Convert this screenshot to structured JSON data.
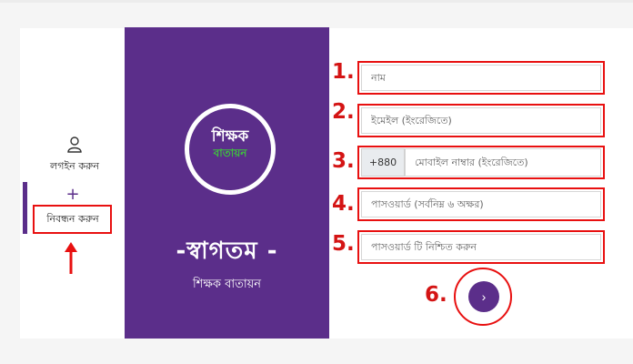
{
  "sidebar": {
    "login_label": "লগইন করুন",
    "register_label": "নিবন্ধন করুন",
    "plus": "+",
    "login_icon": "user-icon"
  },
  "panel": {
    "logo_line1": "শিক্ষক",
    "logo_line2": "বাতায়ন",
    "welcome": "-স্বাগতম -",
    "subtitle": "শিক্ষক বাতায়ন"
  },
  "form": {
    "name_placeholder": "নাম",
    "email_placeholder": "ইমেইল (ইংরেজিতে)",
    "phone_prefix": "+880",
    "phone_placeholder": "মোবাইল নাম্বার (ইংরেজিতে)",
    "password_placeholder": "পাসওয়ার্ড (সর্বনিম্ন ৬ অক্ষর)",
    "confirm_placeholder": "পাসওয়ার্ড টি নিশ্চিত করুন",
    "submit_symbol": "›"
  },
  "annotations": {
    "n1": "1.",
    "n2": "2.",
    "n3": "3.",
    "n4": "4.",
    "n5": "5.",
    "n6": "6."
  },
  "colors": {
    "brand_purple": "#5b2e8a",
    "annotation_red": "#e81010",
    "logo_green": "#3fbf3f"
  }
}
